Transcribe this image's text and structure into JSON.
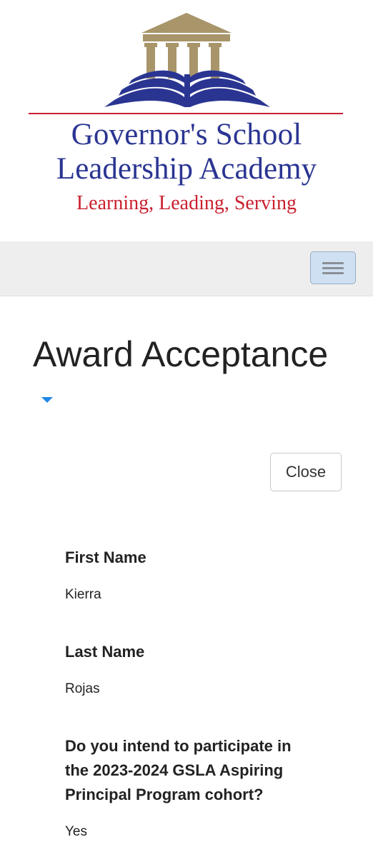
{
  "header": {
    "logo": {
      "line1": "Governor's School",
      "line2": "Leadership Academy",
      "tagline": "Learning, Leading, Serving",
      "colors": {
        "pillars": "#a8956a",
        "book": "#2a3592",
        "rule": "#c9202f",
        "tagline": "#c9202f"
      }
    },
    "nav_toggle_icon": "hamburger-menu-icon"
  },
  "page": {
    "title": "Award Acceptance",
    "title_dropdown_icon": "caret-down-icon",
    "close_label": "Close"
  },
  "fields": [
    {
      "label": "First Name",
      "value": "Kierra"
    },
    {
      "label": "Last Name",
      "value": "Rojas"
    },
    {
      "label": "Do you intend to participate in the 2023-2024 GSLA Aspiring Principal Program cohort?",
      "value": "Yes"
    }
  ],
  "colors": {
    "accent": "#1e88e5",
    "navbar": "#eeeeee",
    "toggle": "#cfe0f2"
  }
}
